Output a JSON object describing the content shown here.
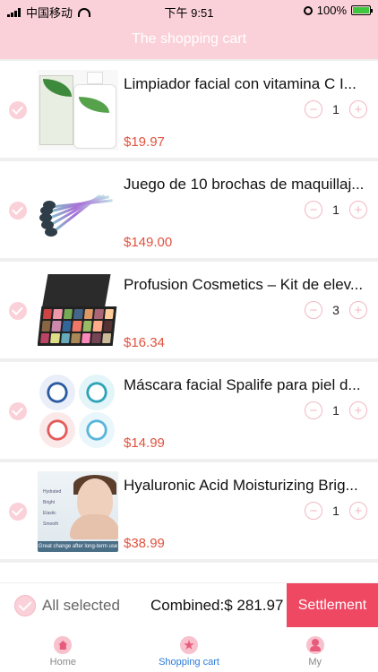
{
  "status_bar": {
    "carrier": "中国移动",
    "time": "下午 9:51",
    "battery": "100%"
  },
  "header": {
    "title": "The shopping cart"
  },
  "cart": {
    "items": [
      {
        "name": "Limpiador facial con vitamina C I...",
        "price": "$19.97",
        "quantity": "1",
        "image_icon": "cleanser-bottle-image"
      },
      {
        "name": "Juego de 10 brochas de maquillaj...",
        "price": "$149.00",
        "quantity": "1",
        "image_icon": "makeup-brushes-image"
      },
      {
        "name": "Profusion Cosmetics – Kit de elev...",
        "price": "$16.34",
        "quantity": "3",
        "image_icon": "eyeshadow-palette-image"
      },
      {
        "name": "Máscara facial Spalife para piel d...",
        "price": "$14.99",
        "quantity": "1",
        "image_icon": "face-mask-image"
      },
      {
        "name": "Hyaluronic Acid Moisturizing Brig...",
        "price": "$38.99",
        "quantity": "1",
        "image_icon": "hyaluronic-serum-image"
      }
    ],
    "minus_symbol": "−",
    "plus_symbol": "+"
  },
  "hyal_image_text": {
    "labels": [
      "Hydrated",
      "Bright",
      "Elastic",
      "Smooth"
    ],
    "caption": "Great change after long-term use"
  },
  "summary": {
    "all_selected_label": "All selected",
    "total_label": "Combined:$",
    "total_value": "281.97",
    "settle_label": "Settlement"
  },
  "tabbar": {
    "tabs": [
      {
        "label": "Home",
        "icon": "home-icon",
        "active": false
      },
      {
        "label": "Shopping cart",
        "icon": "star-icon",
        "active": true
      },
      {
        "label": "My",
        "icon": "user-icon",
        "active": false
      }
    ]
  },
  "colors": {
    "header_bg": "#fbd1d9",
    "price": "#e0523e",
    "settle_bg": "#ee4863",
    "active_tab": "#2a7bd6"
  }
}
